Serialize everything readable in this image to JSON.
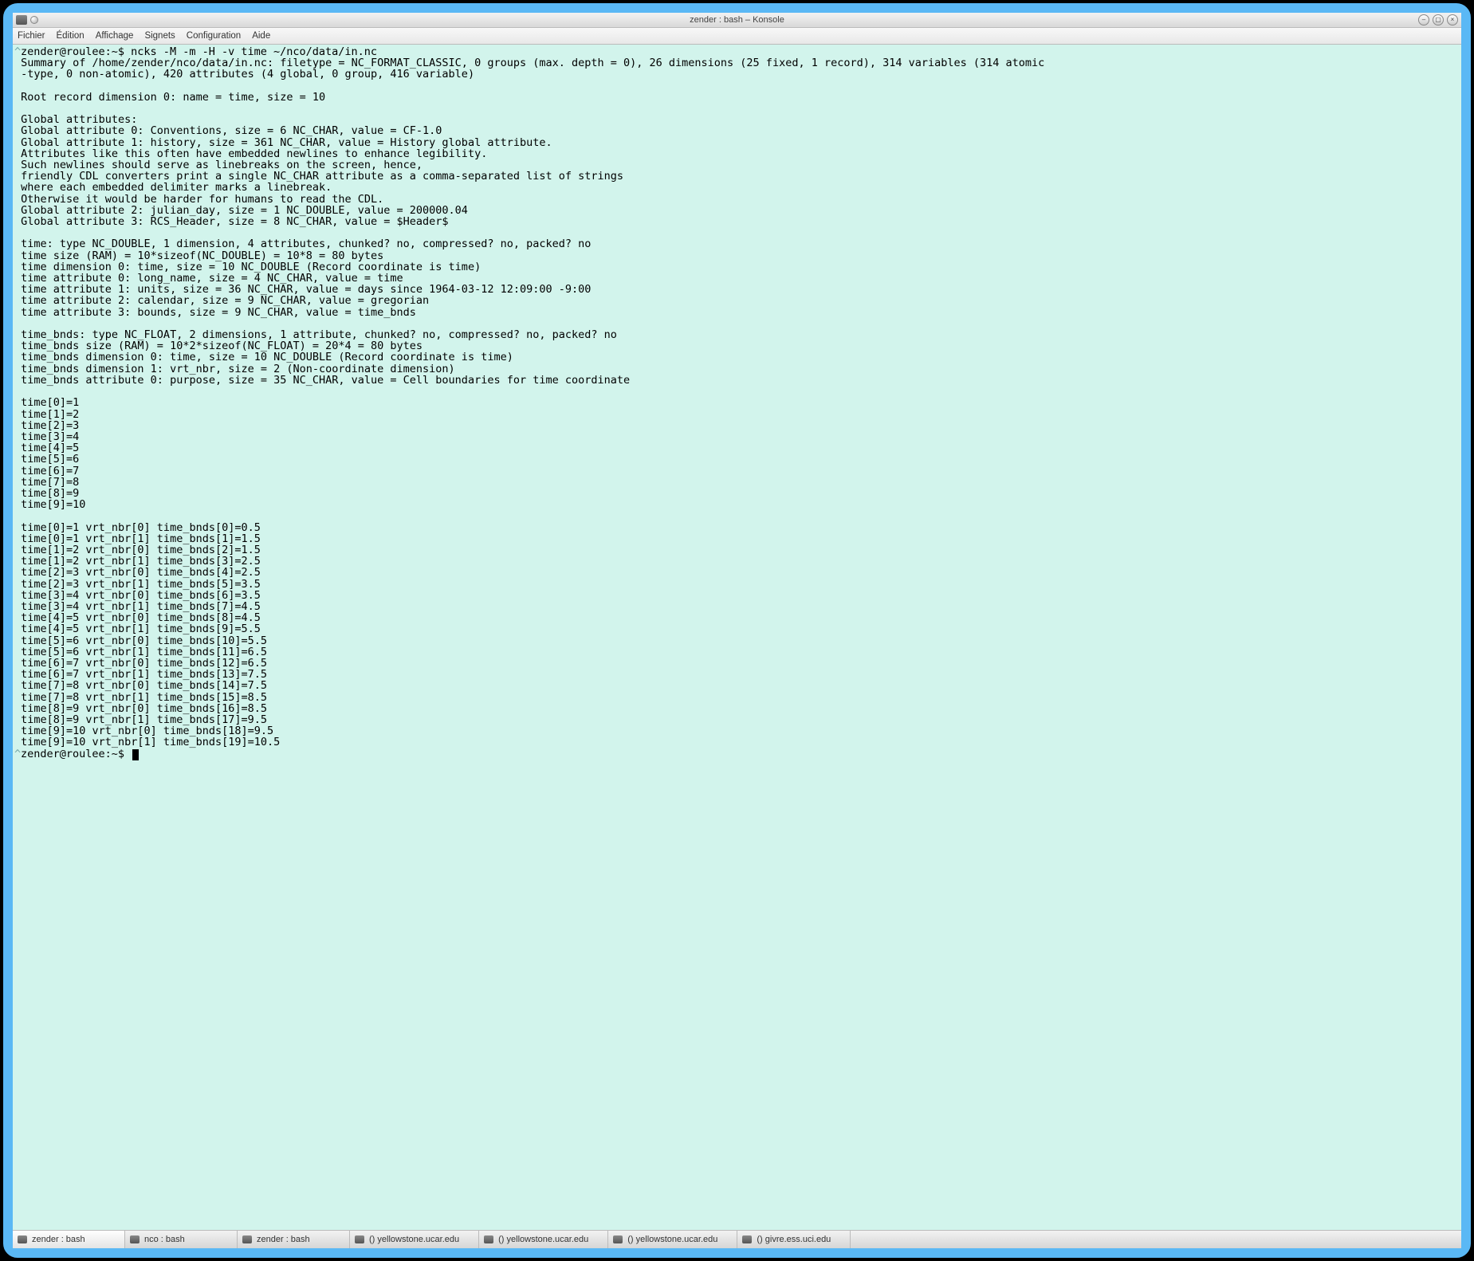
{
  "window": {
    "title": "zender : bash – Konsole"
  },
  "menu": {
    "items": [
      "Fichier",
      "Édition",
      "Affichage",
      "Signets",
      "Configuration",
      "Aide"
    ]
  },
  "terminal": {
    "prompt1_prefix": "^",
    "prompt1": "zender@roulee:~$ ",
    "command": "ncks -M -m -H -v time ~/nco/data/in.nc",
    "lines": [
      "Summary of /home/zender/nco/data/in.nc: filetype = NC_FORMAT_CLASSIC, 0 groups (max. depth = 0), 26 dimensions (25 fixed, 1 record), 314 variables (314 atomic",
      "-type, 0 non-atomic), 420 attributes (4 global, 0 group, 416 variable)",
      "",
      "Root record dimension 0: name = time, size = 10",
      "",
      "Global attributes:",
      "Global attribute 0: Conventions, size = 6 NC_CHAR, value = CF-1.0",
      "Global attribute 1: history, size = 361 NC_CHAR, value = History global attribute.",
      "Attributes like this often have embedded newlines to enhance legibility.",
      "Such newlines should serve as linebreaks on the screen, hence,",
      "friendly CDL converters print a single NC_CHAR attribute as a comma-separated list of strings",
      "where each embedded delimiter marks a linebreak.",
      "Otherwise it would be harder for humans to read the CDL.",
      "Global attribute 2: julian_day, size = 1 NC_DOUBLE, value = 200000.04",
      "Global attribute 3: RCS_Header, size = 8 NC_CHAR, value = $Header$",
      "",
      "time: type NC_DOUBLE, 1 dimension, 4 attributes, chunked? no, compressed? no, packed? no",
      "time size (RAM) = 10*sizeof(NC_DOUBLE) = 10*8 = 80 bytes",
      "time dimension 0: time, size = 10 NC_DOUBLE (Record coordinate is time)",
      "time attribute 0: long_name, size = 4 NC_CHAR, value = time",
      "time attribute 1: units, size = 36 NC_CHAR, value = days since 1964-03-12 12:09:00 -9:00",
      "time attribute 2: calendar, size = 9 NC_CHAR, value = gregorian",
      "time attribute 3: bounds, size = 9 NC_CHAR, value = time_bnds",
      "",
      "time_bnds: type NC_FLOAT, 2 dimensions, 1 attribute, chunked? no, compressed? no, packed? no",
      "time_bnds size (RAM) = 10*2*sizeof(NC_FLOAT) = 20*4 = 80 bytes",
      "time_bnds dimension 0: time, size = 10 NC_DOUBLE (Record coordinate is time)",
      "time_bnds dimension 1: vrt_nbr, size = 2 (Non-coordinate dimension)",
      "time_bnds attribute 0: purpose, size = 35 NC_CHAR, value = Cell boundaries for time coordinate",
      "",
      "time[0]=1",
      "time[1]=2",
      "time[2]=3",
      "time[3]=4",
      "time[4]=5",
      "time[5]=6",
      "time[6]=7",
      "time[7]=8",
      "time[8]=9",
      "time[9]=10",
      "",
      "time[0]=1 vrt_nbr[0] time_bnds[0]=0.5",
      "time[0]=1 vrt_nbr[1] time_bnds[1]=1.5",
      "time[1]=2 vrt_nbr[0] time_bnds[2]=1.5",
      "time[1]=2 vrt_nbr[1] time_bnds[3]=2.5",
      "time[2]=3 vrt_nbr[0] time_bnds[4]=2.5",
      "time[2]=3 vrt_nbr[1] time_bnds[5]=3.5",
      "time[3]=4 vrt_nbr[0] time_bnds[6]=3.5",
      "time[3]=4 vrt_nbr[1] time_bnds[7]=4.5",
      "time[4]=5 vrt_nbr[0] time_bnds[8]=4.5",
      "time[4]=5 vrt_nbr[1] time_bnds[9]=5.5",
      "time[5]=6 vrt_nbr[0] time_bnds[10]=5.5",
      "time[5]=6 vrt_nbr[1] time_bnds[11]=6.5",
      "time[6]=7 vrt_nbr[0] time_bnds[12]=6.5",
      "time[6]=7 vrt_nbr[1] time_bnds[13]=7.5",
      "time[7]=8 vrt_nbr[0] time_bnds[14]=7.5",
      "time[7]=8 vrt_nbr[1] time_bnds[15]=8.5",
      "time[8]=9 vrt_nbr[0] time_bnds[16]=8.5",
      "time[8]=9 vrt_nbr[1] time_bnds[17]=9.5",
      "time[9]=10 vrt_nbr[0] time_bnds[18]=9.5",
      "time[9]=10 vrt_nbr[1] time_bnds[19]=10.5"
    ],
    "prompt2_prefix": "^",
    "prompt2": "zender@roulee:~$ "
  },
  "tabs": [
    {
      "label": "zender : bash",
      "active": true
    },
    {
      "label": "nco : bash",
      "active": false
    },
    {
      "label": "zender : bash",
      "active": false
    },
    {
      "label": "() yellowstone.ucar.edu",
      "active": false
    },
    {
      "label": "() yellowstone.ucar.edu",
      "active": false
    },
    {
      "label": "() yellowstone.ucar.edu",
      "active": false
    },
    {
      "label": "() givre.ess.uci.edu",
      "active": false
    }
  ]
}
